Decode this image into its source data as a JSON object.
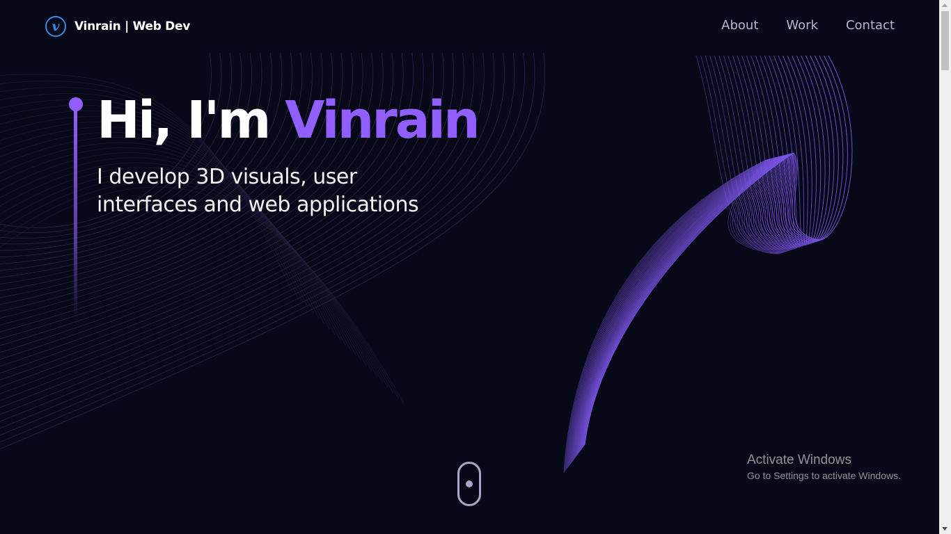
{
  "nav": {
    "brand_logo_letter": "v",
    "brand_name": "Vinrain | Web Dev",
    "links": [
      {
        "label": "About"
      },
      {
        "label": "Work"
      },
      {
        "label": "Contact"
      }
    ]
  },
  "hero": {
    "title_prefix": "Hi, I'm ",
    "title_name": "Vinrain",
    "subtitle_line1": "I develop 3D visuals, user",
    "subtitle_line2": "interfaces and web applications"
  },
  "watermark": {
    "title": "Activate Windows",
    "subtitle": "Go to Settings to activate Windows."
  },
  "colors": {
    "background": "#070918",
    "accent": "#915eff",
    "logo_blue": "#2f8fe8",
    "nav_text": "#b8b4d0"
  },
  "icons": {
    "brand": "v-logo-icon",
    "scroll": "mouse-scroll-icon"
  }
}
